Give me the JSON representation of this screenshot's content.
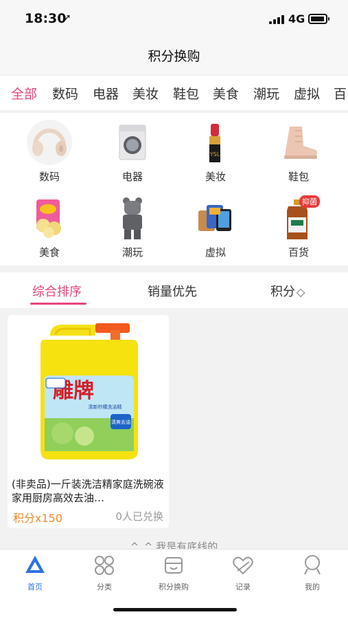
{
  "status": {
    "time": "18:30",
    "network": "4G",
    "battery_level": 0.8
  },
  "nav": {
    "title": "积分换购"
  },
  "category_tabs": [
    "全部",
    "数码",
    "电器",
    "美妆",
    "鞋包",
    "美食",
    "潮玩",
    "虚拟",
    "百"
  ],
  "category_grid": [
    {
      "label": "数码",
      "icon": "headphones-icon"
    },
    {
      "label": "电器",
      "icon": "washing-machine-icon"
    },
    {
      "label": "美妆",
      "icon": "lipstick-icon"
    },
    {
      "label": "鞋包",
      "icon": "boot-icon"
    },
    {
      "label": "美食",
      "icon": "snack-icon"
    },
    {
      "label": "潮玩",
      "icon": "bear-figure-icon"
    },
    {
      "label": "虚拟",
      "icon": "cards-icon"
    },
    {
      "label": "百货",
      "icon": "disinfectant-icon",
      "badge": "抑菌"
    }
  ],
  "sort": {
    "items": [
      "综合排序",
      "销量优先",
      "积分"
    ],
    "sort_icon": "◇"
  },
  "product": {
    "name": "(非卖品)一斤装洗洁精家庭洗碗液家用厨房高效去油…",
    "price": "积分x150",
    "sold": "0人已兑换",
    "bottle_brand": "雕牌",
    "bottle_sub": "清新柠檬洗洁精",
    "bottle_badge": "清爽去油"
  },
  "bottom_text": "^_^ 我是有底线的",
  "tab_bar": [
    {
      "label": "首页",
      "icon": "home-icon"
    },
    {
      "label": "分类",
      "icon": "category-icon"
    },
    {
      "label": "积分换购",
      "icon": "points-shop-icon"
    },
    {
      "label": "记录",
      "icon": "record-icon"
    },
    {
      "label": "我的",
      "icon": "profile-icon"
    }
  ],
  "colors": {
    "accent": "#e8457a",
    "price": "#f08a2c",
    "tab_active": "#2c73e8"
  }
}
